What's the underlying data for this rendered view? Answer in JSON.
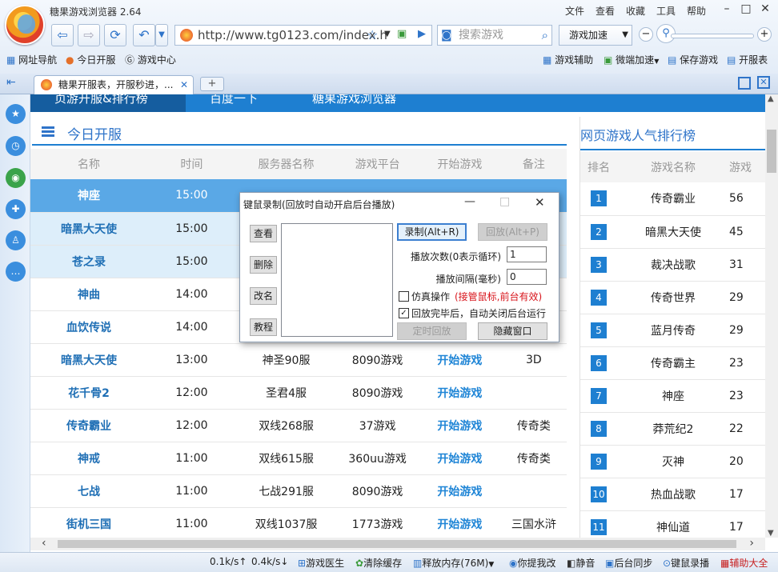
{
  "browser": {
    "app_title": "糖果游戏浏览器 2.64",
    "menu": [
      "文件",
      "查看",
      "收藏",
      "工具",
      "帮助"
    ],
    "url": "http://www.tg0123.com/index.h",
    "search_placeholder": "搜索游戏",
    "speed_label": "游戏加速",
    "bookmarks_left": [
      "网址导航",
      "今日开服",
      "游戏中心"
    ],
    "bookmarks_right": [
      "游戏辅助",
      "微端加速",
      "保存游戏",
      "开服表"
    ],
    "tab_title": "糖果开服表，开服秒进，..."
  },
  "page": {
    "top_strip": [
      "页游开服&排行榜",
      "百度一下",
      "糖果游戏浏览器"
    ],
    "today_title": "今日开服",
    "columns": [
      "名称",
      "时间",
      "服务器名称",
      "游戏平台",
      "开始游戏",
      "备注"
    ],
    "rows": [
      {
        "name": "神座",
        "time": "15:00",
        "server": "",
        "platform": "",
        "start": "",
        "note": ""
      },
      {
        "name": "暗黑大天使",
        "time": "15:00",
        "server": "",
        "platform": "",
        "start": "",
        "note": ""
      },
      {
        "name": "苍之录",
        "time": "15:00",
        "server": "",
        "platform": "",
        "start": "",
        "note": ""
      },
      {
        "name": "神曲",
        "time": "14:00",
        "server": "",
        "platform": "",
        "start": "",
        "note": ""
      },
      {
        "name": "血饮传说",
        "time": "14:00",
        "server": "",
        "platform": "",
        "start": "",
        "note": ""
      },
      {
        "name": "暗黑大天使",
        "time": "13:00",
        "server": "神圣90服",
        "platform": "8090游戏",
        "start": "开始游戏",
        "note": "3D"
      },
      {
        "name": "花千骨2",
        "time": "12:00",
        "server": "圣君4服",
        "platform": "8090游戏",
        "start": "开始游戏",
        "note": ""
      },
      {
        "name": "传奇霸业",
        "time": "12:00",
        "server": "双线268服",
        "platform": "37游戏",
        "start": "开始游戏",
        "note": "传奇类"
      },
      {
        "name": "神戒",
        "time": "11:00",
        "server": "双线615服",
        "platform": "360uu游戏",
        "start": "开始游戏",
        "note": "传奇类"
      },
      {
        "name": "七战",
        "time": "11:00",
        "server": "七战291服",
        "platform": "8090游戏",
        "start": "开始游戏",
        "note": ""
      },
      {
        "name": "街机三国",
        "time": "11:00",
        "server": "双线1037服",
        "platform": "1773游戏",
        "start": "开始游戏",
        "note": "三国水浒"
      }
    ],
    "ranking_title": "网页游戏人气排行榜",
    "ranking_columns": [
      "排名",
      "游戏名称",
      "游戏"
    ],
    "ranking": [
      {
        "rank": "1",
        "name": "传奇霸业",
        "val": "56"
      },
      {
        "rank": "2",
        "name": "暗黑大天使",
        "val": "45"
      },
      {
        "rank": "3",
        "name": "裁决战歌",
        "val": "31"
      },
      {
        "rank": "4",
        "name": "传奇世界",
        "val": "29"
      },
      {
        "rank": "5",
        "name": "蓝月传奇",
        "val": "29"
      },
      {
        "rank": "6",
        "name": "传奇霸主",
        "val": "23"
      },
      {
        "rank": "7",
        "name": "神座",
        "val": "23"
      },
      {
        "rank": "8",
        "name": "莽荒纪2",
        "val": "22"
      },
      {
        "rank": "9",
        "name": "灭神",
        "val": "20"
      },
      {
        "rank": "10",
        "name": "热血战歌",
        "val": "17"
      },
      {
        "rank": "11",
        "name": "神仙道",
        "val": "17"
      }
    ]
  },
  "dialog": {
    "title": "键鼠录制(回放时自动开启后台播放)",
    "left_buttons": [
      "查看",
      "删除",
      "改名",
      "教程"
    ],
    "record_label": "录制(Alt+R)",
    "replay_label": "回放(Alt+P)",
    "replay_count_label": "播放次数(0表示循环)",
    "replay_count_value": "1",
    "interval_label": "播放间隔(毫秒)",
    "interval_value": "0",
    "simulate_label": "仿真操作",
    "simulate_note": "(接管鼠标,前台有效)",
    "autoclose_label": "回放完毕后，自动关闭后台运行",
    "timed_label": "定时回放",
    "hide_label": "隐藏窗口"
  },
  "status": {
    "down": "0.1k/s↑",
    "up": "0.4k/s↓",
    "items": [
      "游戏医生",
      "清除缓存",
      "释放内存(76M)",
      "你提我改",
      "静音",
      "后台同步",
      "键鼠录播",
      "辅助大全"
    ]
  }
}
